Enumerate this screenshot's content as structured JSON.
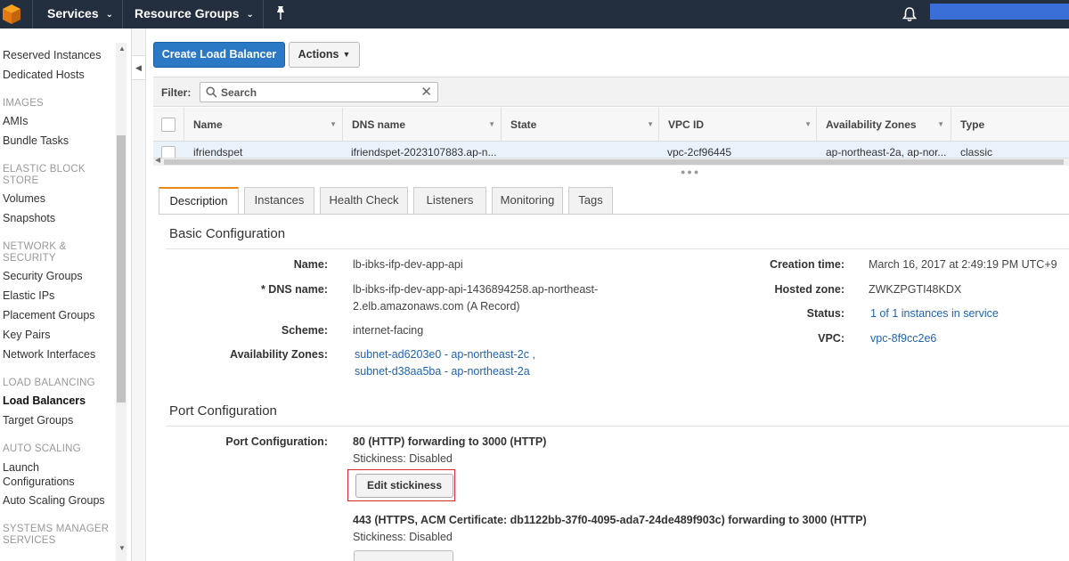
{
  "topnav": {
    "services_label": "Services",
    "resource_groups_label": "Resource Groups"
  },
  "sidebar": {
    "items_top": [
      "Reserved Instances",
      "Dedicated Hosts"
    ],
    "images_section": "IMAGES",
    "images_items": [
      "AMIs",
      "Bundle Tasks"
    ],
    "ebs_section_line1": "ELASTIC BLOCK",
    "ebs_section_line2": "STORE",
    "ebs_items": [
      "Volumes",
      "Snapshots"
    ],
    "net_section_line1": "NETWORK &",
    "net_section_line2": "SECURITY",
    "net_items": [
      "Security Groups",
      "Elastic IPs",
      "Placement Groups",
      "Key Pairs",
      "Network Interfaces"
    ],
    "lb_section": "LOAD BALANCING",
    "lb_items": [
      "Load Balancers",
      "Target Groups"
    ],
    "as_section": "AUTO SCALING",
    "as_items_line1": "Launch",
    "as_items_line2": "Configurations",
    "as_item_groups": "Auto Scaling Groups",
    "sm_section_line1": "SYSTEMS MANAGER",
    "sm_section_line2": "SERVICES"
  },
  "toolbar": {
    "create_label": "Create Load Balancer",
    "actions_label": "Actions"
  },
  "filter": {
    "label": "Filter:",
    "placeholder": "Search"
  },
  "table": {
    "columns": [
      "Name",
      "DNS name",
      "State",
      "VPC ID",
      "Availability Zones",
      "Type"
    ],
    "row": {
      "name": "ifriendspet",
      "dns": "ifriendspet-2023107883.ap-n...",
      "state": "",
      "vpc": "vpc-2cf96445",
      "zones": "ap-northeast-2a, ap-nor...",
      "type": "classic"
    }
  },
  "tabs": [
    "Description",
    "Instances",
    "Health Check",
    "Listeners",
    "Monitoring",
    "Tags"
  ],
  "basic": {
    "title": "Basic Configuration",
    "name_label": "Name:",
    "name_value": "lb-ibks-ifp-dev-app-api",
    "dns_label": "* DNS name:",
    "dns_value_line1": "lb-ibks-ifp-dev-app-api-1436894258.ap-northeast-",
    "dns_value_line2": "2.elb.amazonaws.com (A Record)",
    "scheme_label": "Scheme:",
    "scheme_value": "internet-facing",
    "az_label": "Availability Zones:",
    "az_value_1": "subnet-ad6203e0 - ap-northeast-2c ,",
    "az_value_2": "subnet-d38aa5ba - ap-northeast-2a",
    "creation_label": "Creation time:",
    "creation_value": "March 16, 2017 at 2:49:19 PM UTC+9",
    "hosted_label": "Hosted zone:",
    "hosted_value": "ZWKZPGTI48KDX",
    "status_label": "Status:",
    "status_value": "1 of 1 instances in service",
    "vpc_label": "VPC:",
    "vpc_value": "vpc-8f9cc2e6"
  },
  "port": {
    "title": "Port Configuration",
    "label": "Port Configuration:",
    "listener1": "80 (HTTP) forwarding to 3000 (HTTP)",
    "stickiness1": "Stickiness: Disabled",
    "edit_label": "Edit stickiness",
    "listener2": "443 (HTTPS, ACM Certificate: db1122bb-37f0-4095-ada7-24de489f903c) forwarding to 3000 (HTTP)",
    "stickiness2": "Stickiness: Disabled"
  },
  "colors": {
    "nav_bg": "#232f3e",
    "primary_button": "#2b78c5",
    "link": "#1f63b4",
    "active_tab_accent": "#e88b16",
    "highlight_box": "#d62b2b"
  }
}
